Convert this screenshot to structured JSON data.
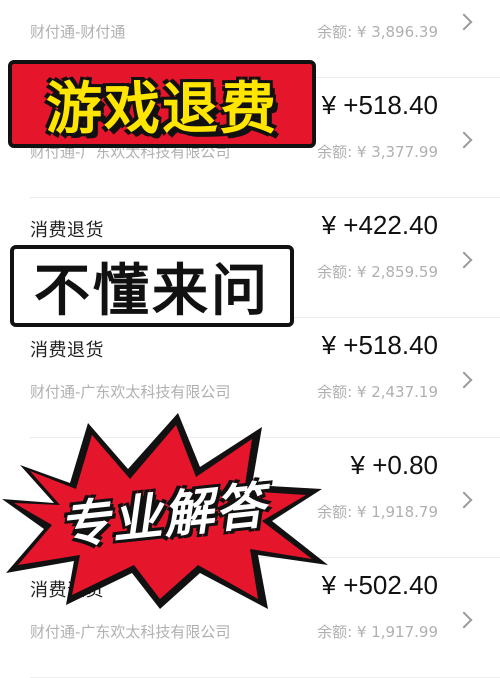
{
  "currency_symbol": "¥",
  "rows": [
    {
      "title": "",
      "amount": "",
      "sub": "财付通-财付通",
      "balance": "余额: ¥ 3,896.39"
    },
    {
      "title": "",
      "amount": "¥ +518.40",
      "sub": "财付通-广东欢太科技有限公司",
      "balance": "余额: ¥ 3,377.99"
    },
    {
      "title": "消费退货",
      "amount": "¥ +422.40",
      "sub": "",
      "balance": "余额: ¥ 2,859.59"
    },
    {
      "title": "消费退货",
      "amount": "¥ +518.40",
      "sub": "财付通-广东欢太科技有限公司",
      "balance": "余额: ¥ 2,437.19"
    },
    {
      "title": "",
      "amount": "¥ +0.80",
      "sub": "",
      "balance": "余额: ¥ 1,918.79"
    },
    {
      "title": "消费退货",
      "amount": "¥ +502.40",
      "sub": "财付通-广东欢太科技有限公司",
      "balance": "余额: ¥ 1,917.99"
    }
  ],
  "overlays": {
    "red_banner": "游戏退费",
    "white_banner": "不懂来问",
    "burst_banner": "专业解答"
  },
  "colors": {
    "red": "#e5152c",
    "yellow": "#ffe500",
    "muted_text": "#b0b0b0"
  }
}
